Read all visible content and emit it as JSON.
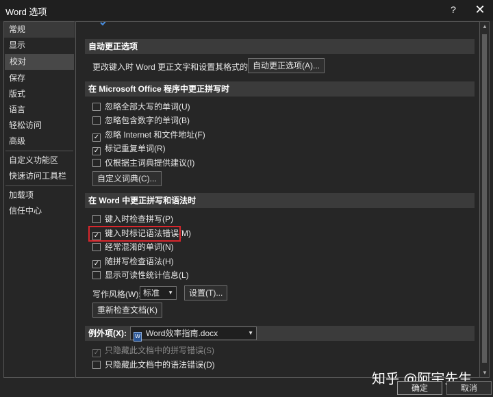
{
  "window": {
    "title": "Word 选项",
    "help_label": "?",
    "close_label": "✕"
  },
  "sidebar": {
    "items": [
      {
        "label": "常规"
      },
      {
        "label": "显示"
      },
      {
        "label": "校对",
        "active": true
      },
      {
        "label": "保存"
      },
      {
        "label": "版式"
      },
      {
        "label": "语言"
      },
      {
        "label": "轻松访问"
      },
      {
        "label": "高级"
      },
      {
        "label": "自定义功能区"
      },
      {
        "label": "快速访问工具栏"
      },
      {
        "label": "加载项"
      },
      {
        "label": "信任中心"
      }
    ]
  },
  "autocorrect": {
    "header": "自动更正选项",
    "description": "更改键入时 Word 更正文字和设置其格式的方式:",
    "button": "自动更正选项(A)..."
  },
  "office_spelling": {
    "header": "在 Microsoft Office 程序中更正拼写时",
    "options": [
      {
        "label": "忽略全部大写的单词(U)",
        "checked": false
      },
      {
        "label": "忽略包含数字的单词(B)",
        "checked": false
      },
      {
        "label": "忽略 Internet 和文件地址(F)",
        "checked": true
      },
      {
        "label": "标记重复单词(R)",
        "checked": true
      },
      {
        "label": "仅根据主词典提供建议(I)",
        "checked": false
      }
    ],
    "dictionary_button": "自定义词典(C)..."
  },
  "word_grammar": {
    "header": "在 Word 中更正拼写和语法时",
    "options": [
      {
        "label": "键入时检查拼写(P)",
        "checked": false
      },
      {
        "label": "键入时标记语法错误(M)",
        "checked": true
      },
      {
        "label": "经常混淆的单词(N)",
        "checked": false
      },
      {
        "label": "随拼写检查语法(H)",
        "checked": true
      },
      {
        "label": "显示可读性统计信息(L)",
        "checked": false
      }
    ],
    "style_label": "写作风格(W):",
    "style_value": "标准",
    "settings_button": "设置(T)...",
    "recheck_button": "重新检查文档(K)"
  },
  "exceptions": {
    "label": "例外项(X):",
    "document": "Word效率指南.docx",
    "options": [
      {
        "label": "只隐藏此文档中的拼写错误(S)",
        "checked": true,
        "disabled": true
      },
      {
        "label": "只隐藏此文档中的语法错误(D)",
        "checked": false,
        "disabled": false
      }
    ]
  },
  "footer": {
    "ok": "确定",
    "cancel": "取消"
  },
  "watermark": "知乎 @阿宇先生",
  "colors": {
    "highlight": "#d9262c",
    "background": "#262626",
    "section_header": "#3b3b3b"
  }
}
